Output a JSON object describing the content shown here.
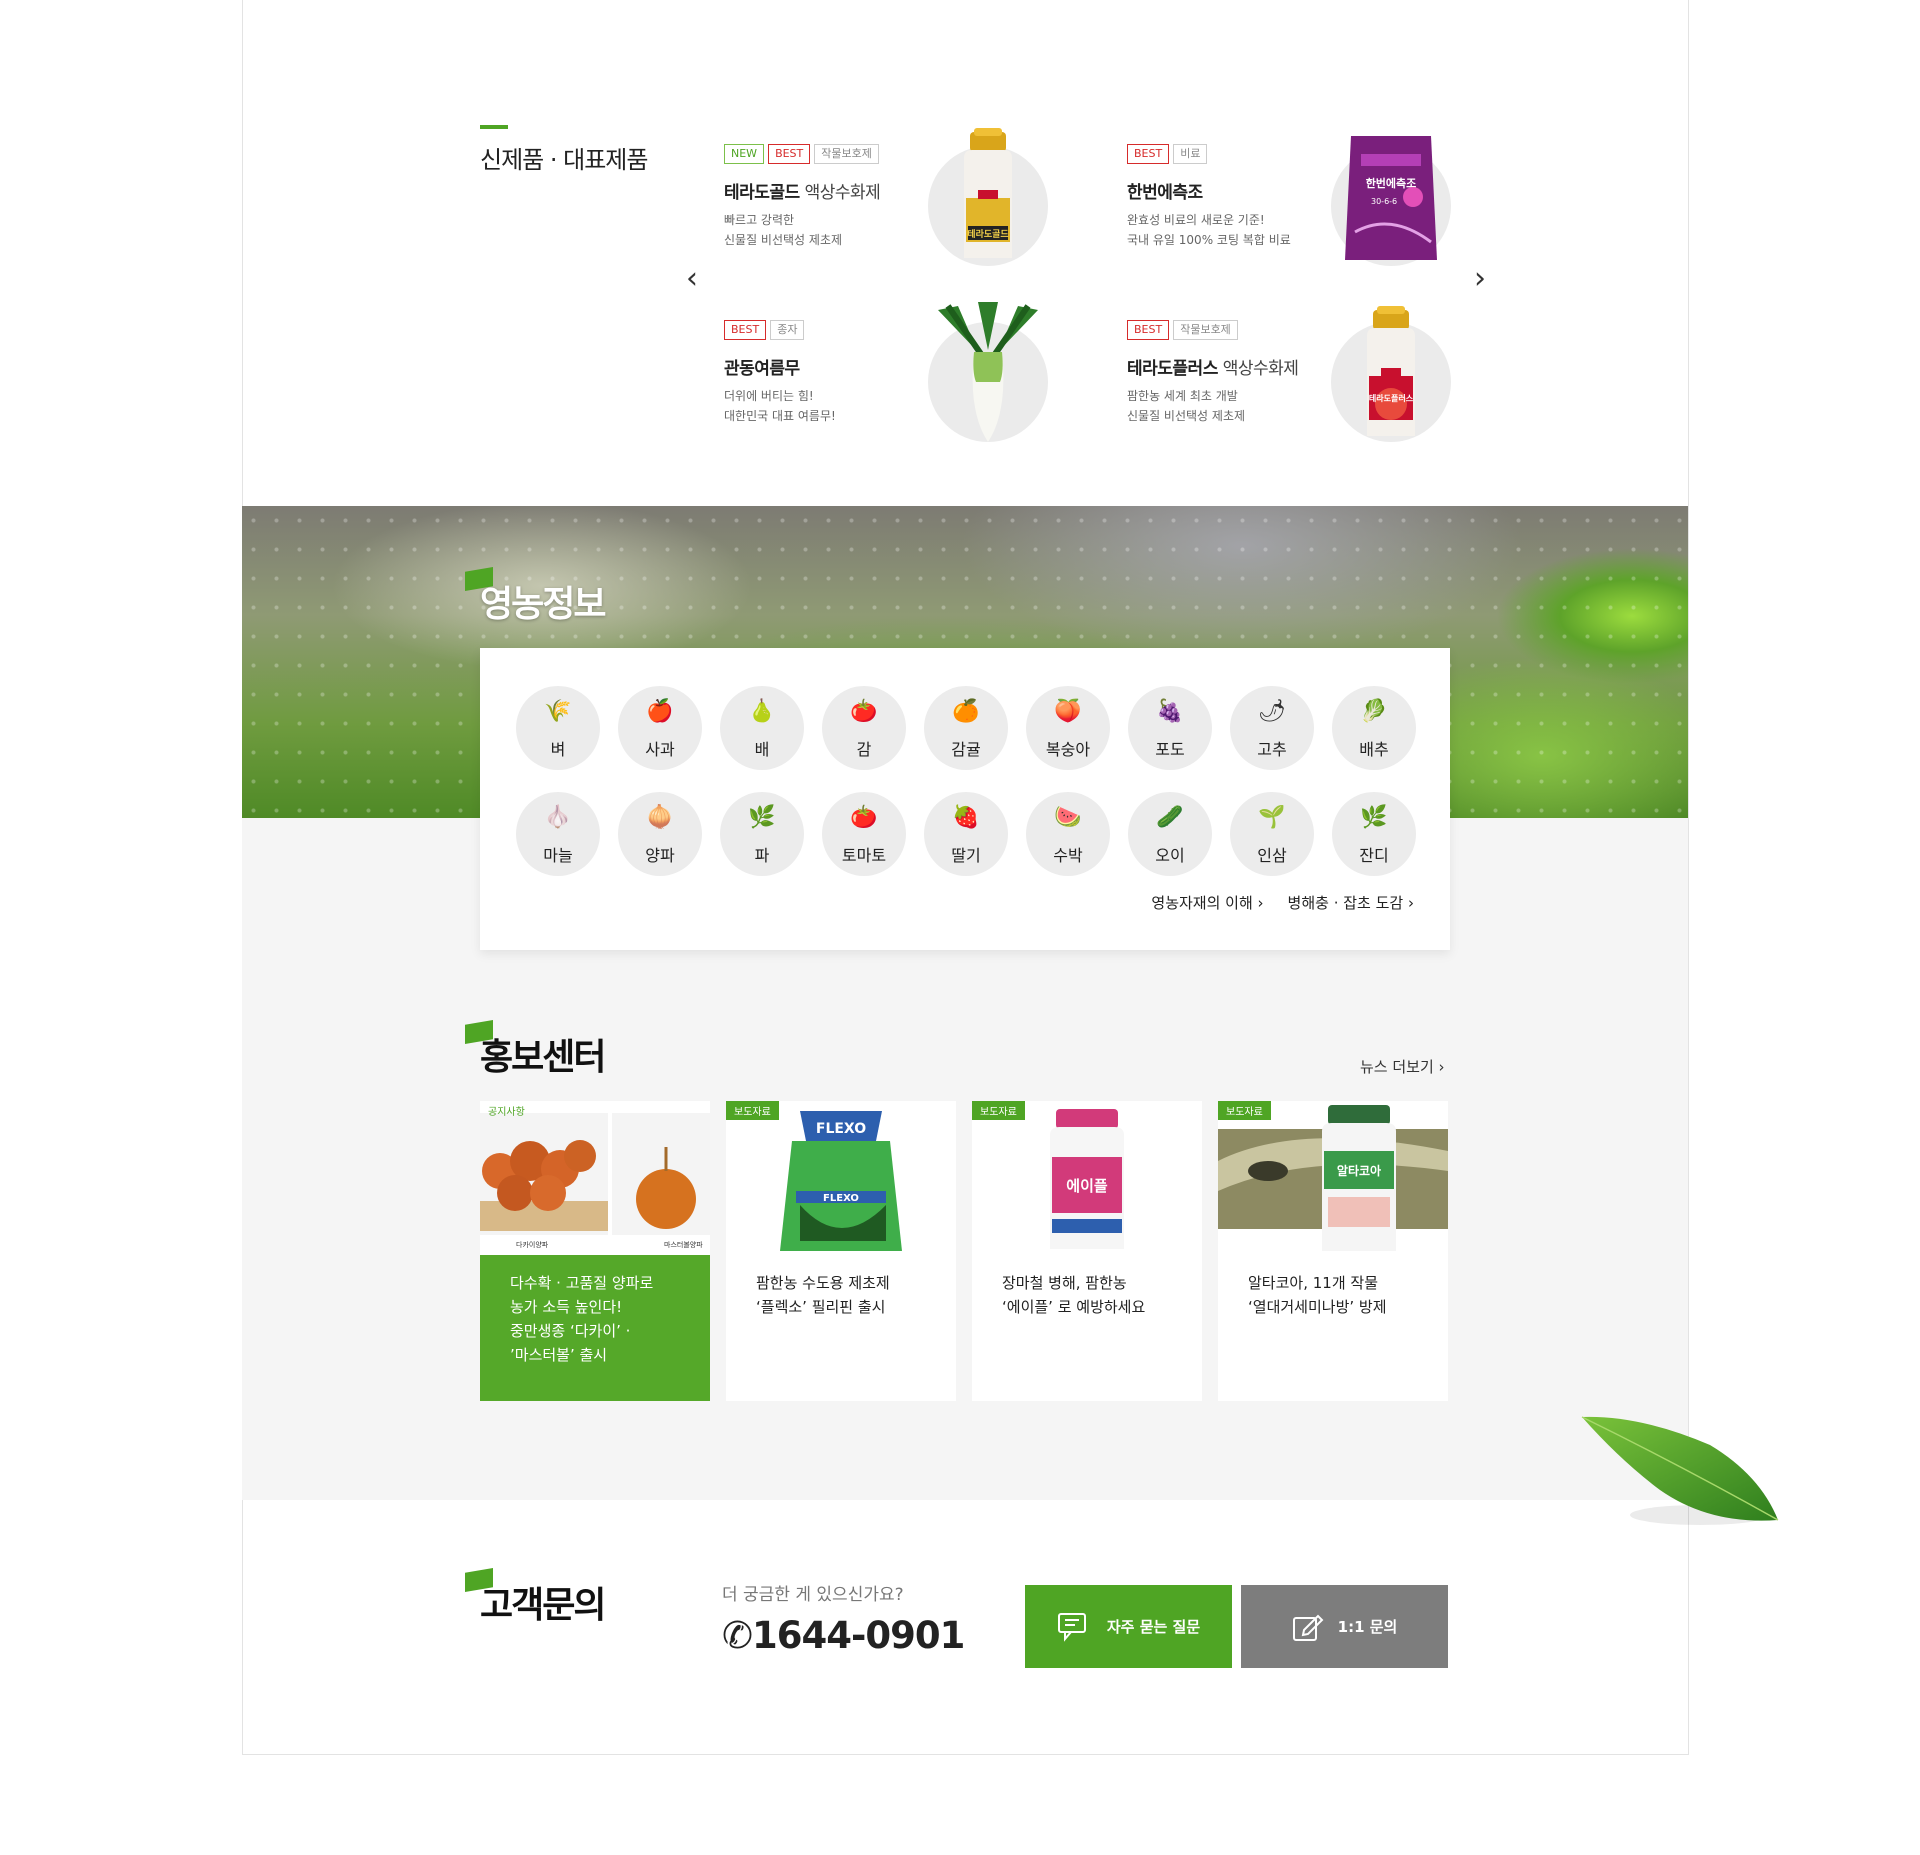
{
  "products": {
    "title": "신제품 · 대표제품",
    "items": [
      {
        "tags": [
          "NEW",
          "BEST",
          "작물보호제"
        ],
        "name": "테라도골드",
        "name_sub": " 액상수화제",
        "desc1": "빠르고 강력한",
        "desc2": "신물질 비선택성 제초제",
        "img_text": "테라도골드"
      },
      {
        "tags": [
          "BEST",
          "비료"
        ],
        "name": "한번에측조",
        "name_sub": "",
        "desc1": "완효성 비료의 새로운 기준!",
        "desc2": "국내 유일 100% 코팅 복합 비료",
        "img_text": "한번에측조",
        "img_code": "30-6-6"
      },
      {
        "tags": [
          "BEST",
          "종자"
        ],
        "name": "관동여름무",
        "name_sub": "",
        "desc1": "더위에 버티는 힘!",
        "desc2": "대한민국 대표 여름무!"
      },
      {
        "tags": [
          "BEST",
          "작물보호제"
        ],
        "name": "테라도플러스",
        "name_sub": " 액상수화제",
        "desc1": "팜한농 세계 최초 개발",
        "desc2": "신물질 비선택성 제초제",
        "img_text": "테라도플러스"
      }
    ]
  },
  "farm_info": {
    "title": "영농정보",
    "crops": [
      "벼",
      "사과",
      "배",
      "감",
      "감귤",
      "복숭아",
      "포도",
      "고추",
      "배추",
      "마늘",
      "양파",
      "파",
      "토마토",
      "딸기",
      "수박",
      "오이",
      "인삼",
      "잔디"
    ],
    "crop_icons": [
      "🌾",
      "🍎",
      "🍐",
      "🍅",
      "🍊",
      "🍑",
      "🍇",
      "🌶",
      "🥬",
      "🧄",
      "🧅",
      "🌿",
      "🍅",
      "🍓",
      "🍉",
      "🥒",
      "🌱",
      "🌿"
    ],
    "link1": "영농자재의 이해 ›",
    "link2": "병해충 · 잡초 도감 ›"
  },
  "pr": {
    "title": "홍보센터",
    "more": "뉴스 더보기 ›",
    "cards": [
      {
        "badge": "공지사항",
        "lines": [
          "다수확 · 고품질 양파로",
          "농가 소득 높인다!",
          "중만생종 ‘다카이’ ·",
          "’마스터볼’ 출시"
        ],
        "cap1": "다카이양파",
        "cap2": "마스터볼양파"
      },
      {
        "badge": "보도자료",
        "lines": [
          "팜한농 수도용 제초제",
          "‘플렉소’ 필리핀 출시"
        ],
        "img_text": "FLEXO"
      },
      {
        "badge": "보도자료",
        "lines": [
          "장마철 병해, 팜한농",
          "‘에이플’ 로 예방하세요"
        ],
        "img_text": "에이플"
      },
      {
        "badge": "보도자료",
        "lines": [
          "알타코아, 11개 작물",
          "‘열대거세미나방’ 방제"
        ],
        "img_text": "알타코아"
      }
    ]
  },
  "customer": {
    "title": "고객문의",
    "question": "더 궁금한 게 있으신가요?",
    "phone": "1644-0901",
    "faq_label": "자주 묻는 질문",
    "inquiry_label": "1:1 문의"
  },
  "colors": {
    "brand_green": "#4fa524",
    "badge_red": "#d62b2b",
    "button_gray": "#7d7d7d"
  }
}
